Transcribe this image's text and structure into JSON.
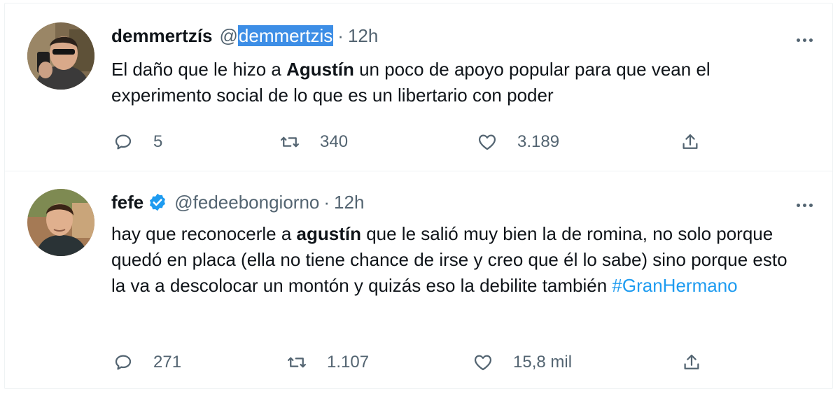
{
  "tweets": [
    {
      "display_name": "demmertzís",
      "handle_prefix": "@",
      "handle_name": "demmertzis",
      "separator": "·",
      "time": "12h",
      "verified": false,
      "text_segments": [
        {
          "text": "El daño que le hizo a ",
          "style": "normal"
        },
        {
          "text": "Agustín",
          "style": "bold"
        },
        {
          "text": " un poco de apoyo popular para que vean el experimento social de lo que es un libertario con poder",
          "style": "normal"
        }
      ],
      "replies": "5",
      "retweets": "340",
      "likes": "3.189",
      "avatar_icon": "user-photo"
    },
    {
      "display_name": "fefe",
      "handle": "@fedeebongiorno",
      "separator": "·",
      "time": "12h",
      "verified": true,
      "text_segments": [
        {
          "text": "hay que reconocerle a ",
          "style": "normal"
        },
        {
          "text": "agustín",
          "style": "bold"
        },
        {
          "text": " que le salió muy bien la de romina, no solo porque quedó en placa (ella no tiene chance de irse y creo que él lo sabe) sino porque esto la va a descolocar un montón y quizás eso la debilite también ",
          "style": "normal"
        },
        {
          "text": "#GranHermano",
          "style": "hashtag"
        }
      ],
      "replies": "271",
      "retweets": "1.107",
      "likes": "15,8 mil",
      "avatar_icon": "user-photo"
    }
  ],
  "icons": {
    "reply": "reply-icon",
    "retweet": "retweet-icon",
    "like": "like-icon",
    "share": "share-icon",
    "more": "more-icon",
    "verified": "verified-badge-icon"
  },
  "colors": {
    "text": "#0f1419",
    "secondary": "#536471",
    "accent": "#1d9bf0",
    "selection": "#3d8ee6",
    "border": "#eff3f4"
  }
}
